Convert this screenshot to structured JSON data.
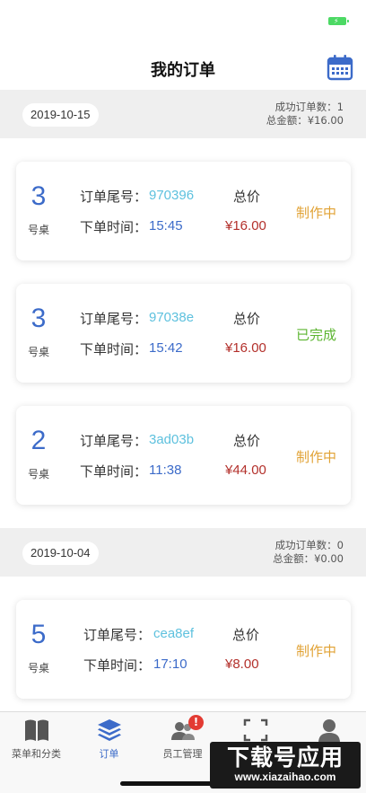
{
  "nav": {
    "title": "我的订单"
  },
  "labels": {
    "order_code": "订单尾号：",
    "order_time": "下单时间：",
    "total": "总价",
    "table_unit": "号桌"
  },
  "groups": [
    {
      "date": "2019-10-15",
      "success_count": "成功订单数：1",
      "total_amount": "总金额：¥16.00",
      "orders": [
        {
          "table": "3",
          "code": "970396",
          "time": "15:45",
          "total": "¥16.00",
          "status": "制作中",
          "status_type": "making"
        },
        {
          "table": "3",
          "code": "97038e",
          "time": "15:42",
          "total": "¥16.00",
          "status": "已完成",
          "status_type": "done"
        },
        {
          "table": "2",
          "code": "3ad03b",
          "time": "11:38",
          "total": "¥44.00",
          "status": "制作中",
          "status_type": "making"
        }
      ]
    },
    {
      "date": "2019-10-04",
      "success_count": "成功订单数：0",
      "total_amount": "总金额：¥0.00",
      "orders": [
        {
          "table": "5",
          "code": "cea8ef",
          "time": "17:10",
          "total": "¥8.00",
          "status": "制作中",
          "status_type": "making"
        }
      ]
    }
  ],
  "tabs": [
    {
      "label": "菜单和分类",
      "icon": "book-icon",
      "active": false
    },
    {
      "label": "订单",
      "icon": "layers-icon",
      "active": true
    },
    {
      "label": "员工管理",
      "icon": "staff-icon",
      "active": false,
      "badge": "!"
    },
    {
      "label": "",
      "icon": "scan-icon",
      "active": false
    },
    {
      "label": "",
      "icon": "profile-icon",
      "active": false
    }
  ],
  "watermark": {
    "title": "下载号应用",
    "url": "www.xiazaihao.com"
  },
  "colors": {
    "accent": "#3c6bc9",
    "code": "#5ec1de",
    "price": "#b3302b",
    "making": "#e1a234",
    "done": "#5cb531",
    "badge": "#e33b33"
  }
}
